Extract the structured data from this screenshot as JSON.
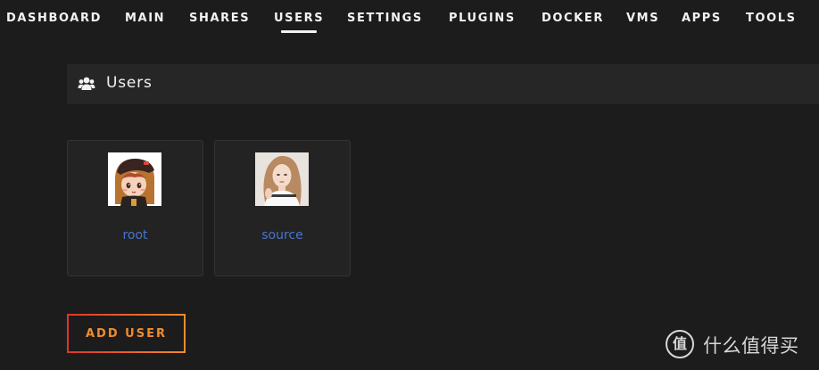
{
  "nav": {
    "items": [
      {
        "label": "DASHBOARD"
      },
      {
        "label": "MAIN"
      },
      {
        "label": "SHARES"
      },
      {
        "label": "USERS"
      },
      {
        "label": "SETTINGS"
      },
      {
        "label": "PLUGINS"
      },
      {
        "label": "DOCKER"
      },
      {
        "label": "VMS"
      },
      {
        "label": "APPS"
      },
      {
        "label": "TOOLS"
      }
    ],
    "active": "USERS"
  },
  "section": {
    "title": "Users",
    "icon": "users-icon"
  },
  "users": [
    {
      "name": "root",
      "avatar": "cartoon-avatar"
    },
    {
      "name": "source",
      "avatar": "photo-avatar"
    }
  ],
  "actions": {
    "add_user_label": "ADD USER"
  },
  "watermark": {
    "badge": "值",
    "text": "什么值得买"
  },
  "colors": {
    "background": "#1c1c1c",
    "header_bg": "#262626",
    "card_bg": "#232323",
    "link": "#4a74c9",
    "accent_start": "#e0342a",
    "accent_end": "#f18b2e",
    "text": "#f2f2f2"
  }
}
